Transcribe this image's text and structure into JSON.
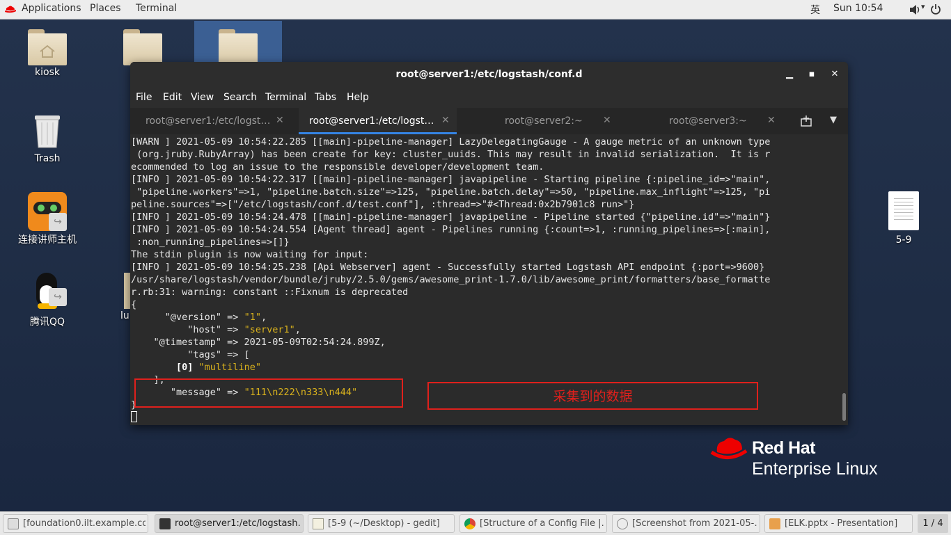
{
  "top_bar": {
    "applications": "Applications",
    "places": "Places",
    "terminal": "Terminal",
    "input_method": "英",
    "clock": "Sun 10:54"
  },
  "desktop": {
    "icons": [
      {
        "label": "kiosk"
      },
      {
        "label": "Trash"
      },
      {
        "label": "连接讲师主机"
      },
      {
        "label": "腾讯QQ"
      },
      {
        "label": "lu"
      },
      {
        "label": "5-9"
      }
    ]
  },
  "terminal": {
    "title": "root@server1:/etc/logstash/conf.d",
    "menu": [
      "File",
      "Edit",
      "View",
      "Search",
      "Terminal",
      "Tabs",
      "Help"
    ],
    "tabs": [
      {
        "label": "root@server1:/etc/logst…"
      },
      {
        "label": "root@server1:/etc/logst…"
      },
      {
        "label": "root@server2:~"
      },
      {
        "label": "root@server3:~"
      }
    ],
    "lines": [
      "[WARN ] 2021-05-09 10:54:22.285 [[main]-pipeline-manager] LazyDelegatingGauge - A gauge metric of an unknown type",
      " (org.jruby.RubyArray) has been create for key: cluster_uuids. This may result in invalid serialization.  It is r",
      "ecommended to log an issue to the responsible developer/development team.",
      "[INFO ] 2021-05-09 10:54:22.317 [[main]-pipeline-manager] javapipeline - Starting pipeline {:pipeline_id=>\"main\",",
      " \"pipeline.workers\"=>1, \"pipeline.batch.size\"=>125, \"pipeline.batch.delay\"=>50, \"pipeline.max_inflight\"=>125, \"pi",
      "peline.sources\"=>[\"/etc/logstash/conf.d/test.conf\"], :thread=>\"#<Thread:0x2b7901c8 run>\"}",
      "[INFO ] 2021-05-09 10:54:24.478 [[main]-pipeline-manager] javapipeline - Pipeline started {\"pipeline.id\"=>\"main\"}",
      "[INFO ] 2021-05-09 10:54:24.554 [Agent thread] agent - Pipelines running {:count=>1, :running_pipelines=>[:main],",
      " :non_running_pipelines=>[]}",
      "The stdin plugin is now waiting for input:",
      "[INFO ] 2021-05-09 10:54:25.238 [Api Webserver] agent - Successfully started Logstash API endpoint {:port=>9600}",
      "/usr/share/logstash/vendor/bundle/jruby/2.5.0/gems/awesome_print-1.7.0/lib/awesome_print/formatters/base_formatte",
      "r.rb:31: warning: constant ::Fixnum is deprecated",
      "{"
    ],
    "record": {
      "version_key": "      \"@version\" => ",
      "version_val": "\"1\"",
      "host_key": "          \"host\" => ",
      "host_val": "\"server1\"",
      "timestamp_line": "    \"@timestamp\" => 2021-05-09T02:54:24.899Z,",
      "tags_line": "          \"tags\" => [",
      "tags_idx": "[0] ",
      "tags_val": "\"multiline\"",
      "close_bracket": "    ],",
      "message_key": "       \"message\" => ",
      "message_val": "\"111\\n222\\n333\\n444\"",
      "close_brace": "}"
    }
  },
  "annotation": {
    "text": "采集到的数据",
    "color": "#e0201c"
  },
  "branding": {
    "line1": "Red Hat",
    "line2": "Enterprise Linux"
  },
  "taskbar": {
    "items": [
      {
        "label": "[foundation0.ilt.example.co…",
        "icon": "vm-icon"
      },
      {
        "label": "root@server1:/etc/logstash…",
        "icon": "terminal-icon"
      },
      {
        "label": "[5-9 (~/Desktop) - gedit]",
        "icon": "gedit-icon"
      },
      {
        "label": "[Structure of a Config File |…",
        "icon": "chrome-icon"
      },
      {
        "label": "[Screenshot from 2021-05-…",
        "icon": "image-viewer-icon"
      },
      {
        "label": "[ELK.pptx - Presentation]",
        "icon": "impress-icon"
      }
    ],
    "workspace": "1 / 4"
  }
}
